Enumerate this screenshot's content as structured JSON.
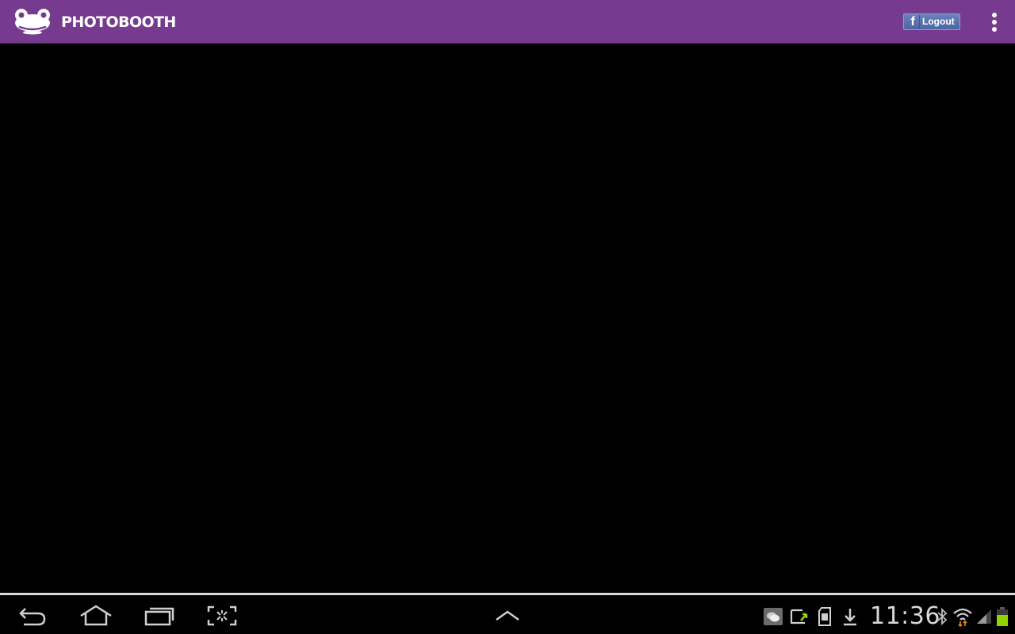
{
  "app": {
    "title": "PHOTOBOOTH",
    "logo_icon": "frog-logo-icon",
    "brand_color": "#763a8e"
  },
  "action_bar": {
    "logout_label": "Logout",
    "facebook_glyph": "f",
    "facebook_color": "#4b66a3",
    "overflow_icon": "more-vertical-icon"
  },
  "content": {
    "background": "#000000"
  },
  "system_bar": {
    "nav_buttons": [
      "back-icon",
      "home-icon",
      "recent-apps-icon",
      "screenshot-icon"
    ],
    "center_button": "chevron-up-icon",
    "notification_icons": [
      "chat-notification-icon",
      "screen-share-icon",
      "sd-card-icon",
      "download-icon"
    ],
    "clock": "11:36",
    "status_icons": [
      "bluetooth-icon",
      "wifi-icon",
      "cell-signal-icon",
      "battery-icon"
    ],
    "battery_color": "#8fd400"
  }
}
